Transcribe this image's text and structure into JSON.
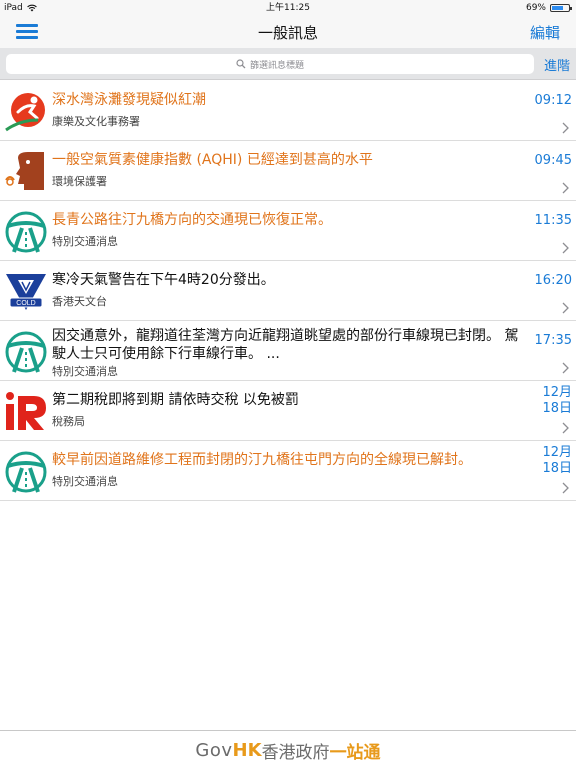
{
  "status": {
    "device": "iPad",
    "time": "上午11:25",
    "battery": "69%",
    "battery_level": 0.69
  },
  "nav": {
    "title": "一般訊息",
    "edit_label": "編輯"
  },
  "search": {
    "placeholder": "篩選訊息標題",
    "advanced_label": "進階"
  },
  "messages": [
    {
      "title": "深水灣泳灘發現疑似紅潮",
      "source": "康樂及文化事務署",
      "time": "09:12",
      "logo": "lcsd-logo",
      "title_color": "orange"
    },
    {
      "title": "一般空氣質素健康指數 (AQHI) 已經達到甚高的水平",
      "source": "環境保護署",
      "time": "09:45",
      "logo": "epd-logo",
      "title_color": "orange"
    },
    {
      "title": "長青公路往汀九橋方向的交通現已恢復正常。",
      "source": "特別交通消息",
      "time": "11:35",
      "logo": "td-logo",
      "title_color": "orange"
    },
    {
      "title": "寒冷天氣警告在下午4時20分發出。",
      "source": "香港天文台",
      "time": "16:20",
      "logo": "hko-cold-logo",
      "logo_text": "COLD",
      "title_color": "dark"
    },
    {
      "title": "因交通意外，龍翔道往荃灣方向近龍翔道眺望處的部份行車線現已封閉。 駕駛人士只可使用餘下行車線行車。 ...",
      "source": "特別交通消息",
      "time": "17:35",
      "logo": "td-logo",
      "title_color": "dark"
    },
    {
      "title": "第二期稅即將到期 請依時交稅 以免被罰",
      "source": "稅務局",
      "time_line1": "12月",
      "time_line2": "18日",
      "logo": "ird-logo",
      "title_color": "dark"
    },
    {
      "title": "較早前因道路維修工程而封閉的汀九橋往屯門方向的全線現已解封。",
      "source": "特別交通消息",
      "time_line1": "12月",
      "time_line2": "18日",
      "logo": "td-logo",
      "title_color": "orange"
    }
  ],
  "footer": {
    "gov": "Gov",
    "hk": "HK",
    "name1": "香港政府",
    "name2": "一站通"
  },
  "colors": {
    "accent": "#1a7bd6",
    "orange": "#e0741b",
    "td_green": "#1aa08a",
    "hko_blue": "#1b3f9b",
    "ird_red": "#e0241b"
  }
}
